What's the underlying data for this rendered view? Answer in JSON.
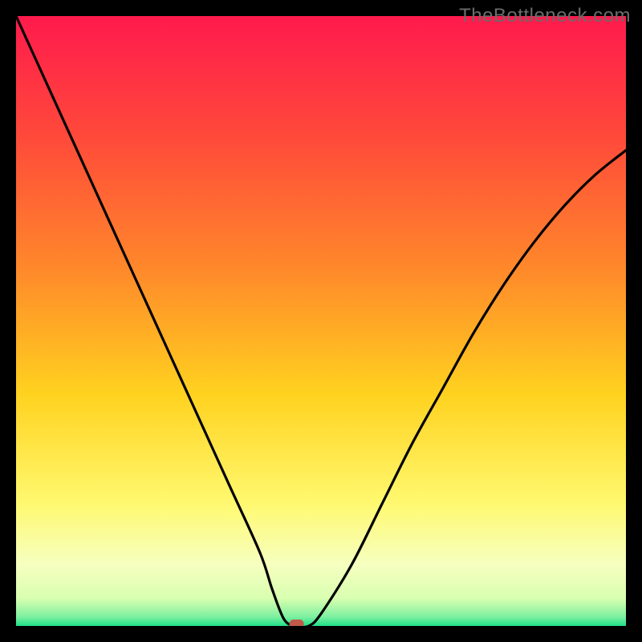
{
  "watermark": "TheBottleneck.com",
  "chart_data": {
    "type": "line",
    "title": "",
    "xlabel": "",
    "ylabel": "",
    "xlim": [
      0,
      100
    ],
    "ylim": [
      0,
      100
    ],
    "x": [
      0,
      5,
      10,
      15,
      20,
      25,
      30,
      35,
      40,
      42,
      44,
      46,
      48,
      50,
      55,
      60,
      65,
      70,
      75,
      80,
      85,
      90,
      95,
      100
    ],
    "values": [
      100,
      89,
      78,
      67,
      56,
      45,
      34,
      23,
      12,
      6,
      1,
      0,
      0,
      2,
      10,
      20,
      30,
      39,
      48,
      56,
      63,
      69,
      74,
      78
    ],
    "minimum_x": 46,
    "marker": {
      "x": 46,
      "y": 0
    },
    "background_gradient": {
      "stops": [
        {
          "offset": 0.0,
          "color": "#ff1a4d"
        },
        {
          "offset": 0.2,
          "color": "#ff4a3a"
        },
        {
          "offset": 0.42,
          "color": "#ff8a2a"
        },
        {
          "offset": 0.62,
          "color": "#ffd21f"
        },
        {
          "offset": 0.8,
          "color": "#fff970"
        },
        {
          "offset": 0.9,
          "color": "#f6ffc0"
        },
        {
          "offset": 0.955,
          "color": "#d8ffb0"
        },
        {
          "offset": 0.985,
          "color": "#7ef0a0"
        },
        {
          "offset": 1.0,
          "color": "#1fe089"
        }
      ]
    }
  }
}
